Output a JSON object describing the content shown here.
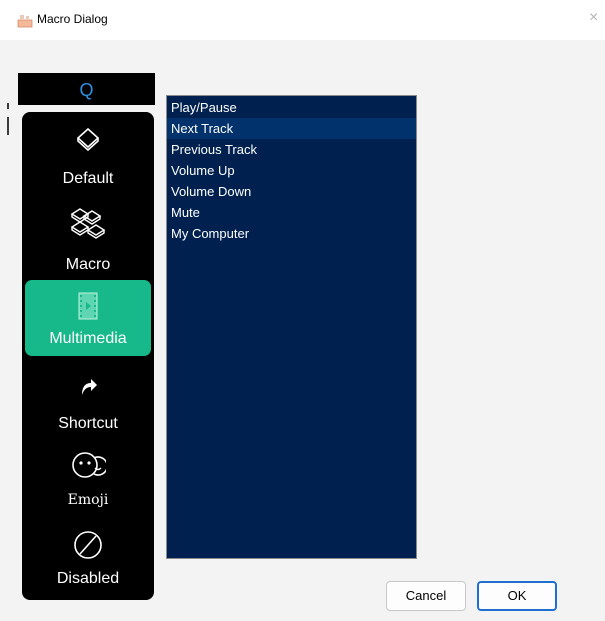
{
  "window": {
    "title": "Macro Dialog",
    "close_glyph": "×"
  },
  "key": {
    "label": "Q",
    "color": "#2e8fe0"
  },
  "sidebar": {
    "items": [
      {
        "label": "Default",
        "icon": "keycap-icon"
      },
      {
        "label": "Macro",
        "icon": "keycaps-cluster-icon"
      },
      {
        "label": "Multimedia",
        "icon": "film-strip-icon",
        "active": true
      },
      {
        "label": "Shortcut",
        "icon": "arrow-icon"
      },
      {
        "label": "Emoji",
        "icon": "emoji-icon"
      },
      {
        "label": "Disabled",
        "icon": "disabled-icon"
      }
    ],
    "active_color": "#17b98a"
  },
  "functions": {
    "items": [
      "Play/Pause",
      "Next Track",
      "Previous Track",
      "Volume Up",
      "Volume Down",
      "Mute",
      "My Computer"
    ],
    "selected": "Next Track",
    "background": "#00214f"
  },
  "buttons": {
    "cancel": "Cancel",
    "ok": "OK"
  }
}
